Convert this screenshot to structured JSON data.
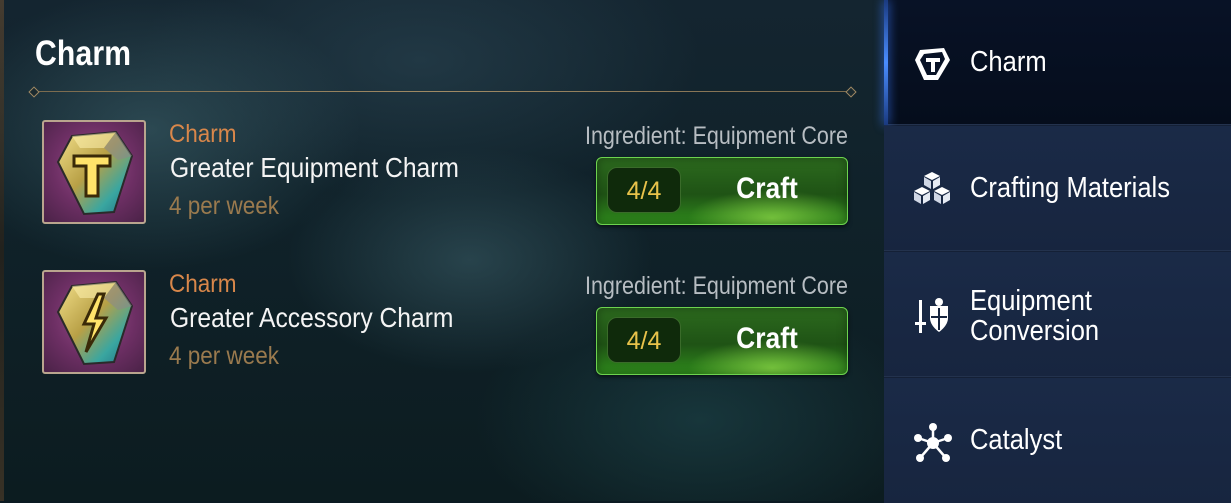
{
  "page": {
    "title": "Charm"
  },
  "items": [
    {
      "category": "Charm",
      "name": "Greater Equipment Charm",
      "limit": "4 per week",
      "ingredient": "Ingredient: Equipment Core",
      "count": "4/4",
      "action": "Craft",
      "icon": "equipment-charm-icon"
    },
    {
      "category": "Charm",
      "name": "Greater Accessory Charm",
      "limit": "4 per week",
      "ingredient": "Ingredient: Equipment Core",
      "count": "4/4",
      "action": "Craft",
      "icon": "accessory-charm-icon"
    }
  ],
  "sidebar": {
    "tabs": [
      {
        "label": "Charm",
        "icon": "charm-gem-icon",
        "active": true
      },
      {
        "label": "Crafting Materials",
        "icon": "cubes-icon",
        "active": false
      },
      {
        "label_line1": "Equipment",
        "label_line2": "Conversion",
        "icon": "sword-shield-icon",
        "active": false
      },
      {
        "label": "Catalyst",
        "icon": "molecule-icon",
        "active": false
      }
    ]
  },
  "colors": {
    "category": "#d9874a",
    "limit": "#9a7a4e",
    "count": "#e8c24a",
    "craft_button": "#2c6a1e",
    "sidebar_bg": "#17253f",
    "active_tab_bg": "#081226",
    "active_indicator": "#4a8cff"
  }
}
